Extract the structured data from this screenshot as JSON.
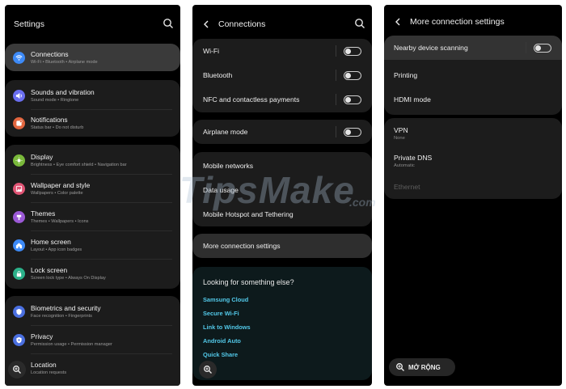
{
  "settings": {
    "title": "Settings",
    "groups": [
      {
        "items": [
          {
            "icon": "wifi-icon",
            "color": "#3d8af7",
            "title": "Connections",
            "subtitle": "Wi-Fi  •  Bluetooth  •  Airplane mode"
          }
        ]
      },
      {
        "items": [
          {
            "icon": "sound-icon",
            "color": "#6a6ef0",
            "title": "Sounds and vibration",
            "subtitle": "Sound mode  •  Ringtone"
          },
          {
            "icon": "notification-icon",
            "color": "#e2663f",
            "title": "Notifications",
            "subtitle": "Status bar  •  Do not disturb"
          }
        ]
      },
      {
        "items": [
          {
            "icon": "display-icon",
            "color": "#7ab93b",
            "title": "Display",
            "subtitle": "Brightness  •  Eye comfort shield  •  Navigation bar"
          },
          {
            "icon": "wallpaper-icon",
            "color": "#e05474",
            "title": "Wallpaper and style",
            "subtitle": "Wallpapers  •  Color palette"
          },
          {
            "icon": "themes-icon",
            "color": "#9b59d6",
            "title": "Themes",
            "subtitle": "Themes  •  Wallpapers  •  Icons"
          },
          {
            "icon": "home-icon",
            "color": "#3d8af7",
            "title": "Home screen",
            "subtitle": "Layout  •  App icon badges"
          },
          {
            "icon": "lock-icon",
            "color": "#2bb18a",
            "title": "Lock screen",
            "subtitle": "Screen lock type  •  Always On Display"
          }
        ]
      },
      {
        "items": [
          {
            "icon": "biometrics-icon",
            "color": "#4a6fe0",
            "title": "Biometrics and security",
            "subtitle": "Face recognition  •  Fingerprints"
          },
          {
            "icon": "privacy-icon",
            "color": "#4a6fe0",
            "title": "Privacy",
            "subtitle": "Permission usage  •  Permission manager"
          },
          {
            "icon": "location-icon",
            "color": "#2bb18a",
            "title": "Location",
            "subtitle": "Location requests"
          }
        ]
      }
    ]
  },
  "connections": {
    "title": "Connections",
    "toggles": [
      "Wi-Fi",
      "Bluetooth",
      "NFC and contactless payments"
    ],
    "airplane": "Airplane mode",
    "network_items": [
      "Mobile networks",
      "Data usage",
      "Mobile Hotspot and Tethering"
    ],
    "more": "More connection settings",
    "looking": {
      "title": "Looking for something else?",
      "links": [
        "Samsung Cloud",
        "Secure Wi-Fi",
        "Link to Windows",
        "Android Auto",
        "Quick Share"
      ]
    }
  },
  "more_settings": {
    "title": "More connection settings",
    "items": [
      "Nearby device scanning",
      "Printing",
      "HDMI mode"
    ],
    "vpn": {
      "label": "VPN",
      "sub": "None"
    },
    "private_dns": {
      "label": "Private DNS",
      "sub": "Automatic"
    },
    "ethernet": "Ethernet",
    "expand_button": "MỞ RỘNG"
  },
  "watermark": {
    "main": "TipsMake",
    "domain": ".com"
  },
  "colors": {
    "link": "#52c8e8",
    "panel_bg": "#000000",
    "card_bg": "#1c1c1c"
  }
}
